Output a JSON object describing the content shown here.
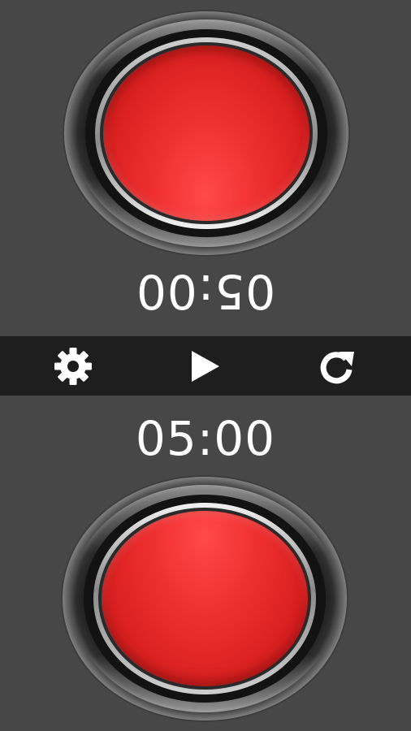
{
  "players": {
    "top": {
      "time": "05:00",
      "button_color": "#e52424"
    },
    "bottom": {
      "time": "05:00",
      "button_color": "#e52424"
    }
  },
  "toolbar": {
    "items": [
      {
        "icon": "gear-icon"
      },
      {
        "icon": "play-icon"
      },
      {
        "icon": "reset-icon"
      }
    ]
  },
  "colors": {
    "background": "#474747",
    "toolbar": "#1e1e1e",
    "text": "#ffffff",
    "accent_red": "#e52424"
  }
}
